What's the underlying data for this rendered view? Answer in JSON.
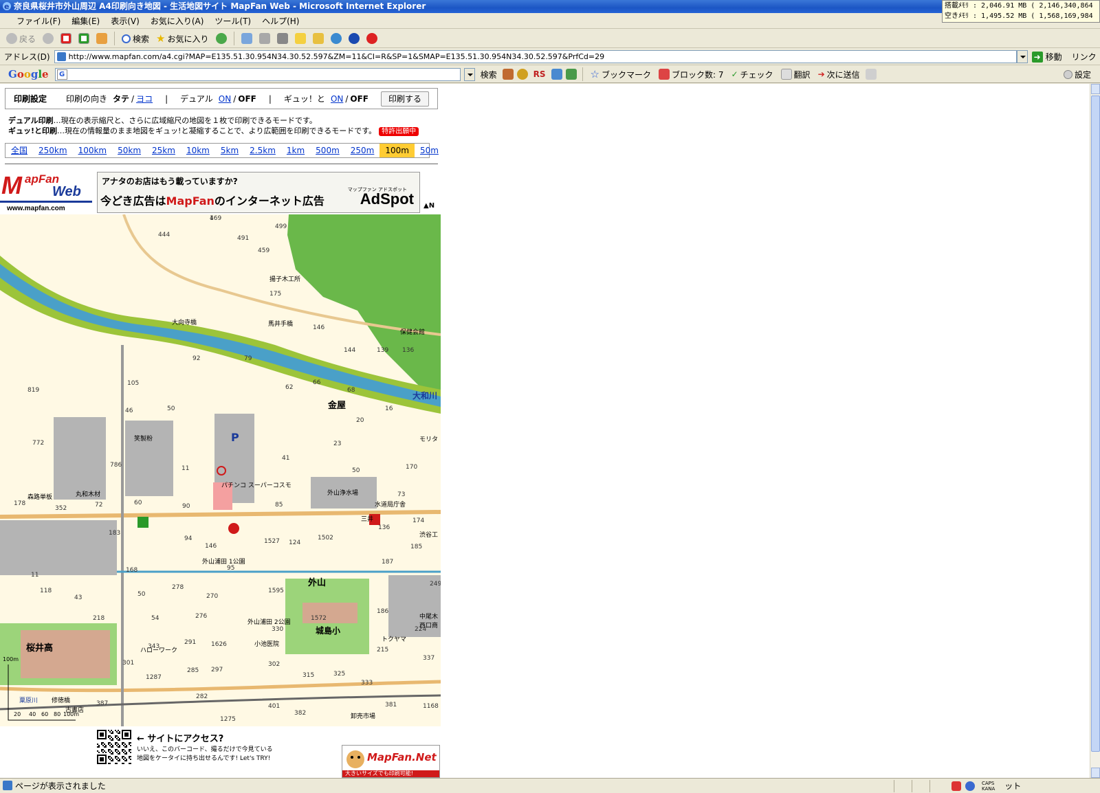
{
  "window": {
    "title": "奈良県桜井市外山周辺 A4印刷向き地図 - 生活地図サイト MapFan Web - Microsoft Internet Explorer",
    "memory_line1": "搭載ﾒﾓﾘ : 2,046.91 MB ( 2,146,340,864",
    "memory_line2": "空きﾒﾓﾘ : 1,495.52 MB ( 1,568,169,984"
  },
  "menu": [
    "ファイル(F)",
    "編集(E)",
    "表示(V)",
    "お気に入り(A)",
    "ツール(T)",
    "ヘルプ(H)"
  ],
  "toolbar": {
    "back": "戻る",
    "search": "検索",
    "favorites": "お気に入り"
  },
  "address": {
    "label": "アドレス(D)",
    "url": "http://www.mapfan.com/a4.cgi?MAP=E135.51.30.954N34.30.52.597&ZM=11&CI=R&SP=1&SMAP=E135.51.30.954N34.30.52.597&PrfCd=29",
    "go": "移動",
    "links": "リンク"
  },
  "googlebar": {
    "logo": [
      "G",
      "o",
      "o",
      "g",
      "l",
      "e"
    ],
    "search_btn": "検索",
    "rs": "RS",
    "bookmarks": "ブックマーク",
    "blocked": "ブロック数: 7",
    "check": "チェック",
    "translate": "翻訳",
    "send": "次に送信",
    "settings": "設定"
  },
  "print": {
    "heading": "印刷設定",
    "orientation_label": "印刷の向き",
    "portrait": "タテ",
    "slash": "/",
    "landscape": "ヨコ",
    "divider": "|",
    "dual_label": "デュアル",
    "on": "ON",
    "off": "OFF",
    "gyutto_label": "ギュッ！と",
    "button": "印刷する"
  },
  "description": {
    "dual_title": "デュアル印刷",
    "dual_text": "…現在の表示縮尺と、さらに広域縮尺の地図を１枚で印刷できるモードです。",
    "gyutto_title": "ギュッ!と印刷",
    "gyutto_text": "…現在の情報量のまま地図をギュッ!と凝縮することで、より広範囲を印刷できるモードです。",
    "patent": "特許出願中"
  },
  "scales": [
    {
      "label": "全国",
      "active": false
    },
    {
      "label": "250km",
      "active": false
    },
    {
      "label": "100km",
      "active": false
    },
    {
      "label": "50km",
      "active": false
    },
    {
      "label": "25km",
      "active": false
    },
    {
      "label": "10km",
      "active": false
    },
    {
      "label": "5km",
      "active": false
    },
    {
      "label": "2.5km",
      "active": false
    },
    {
      "label": "1km",
      "active": false
    },
    {
      "label": "500m",
      "active": false
    },
    {
      "label": "250m",
      "active": false
    },
    {
      "label": "100m",
      "active": true
    },
    {
      "label": "50m",
      "active": false
    }
  ],
  "logo": {
    "line1": "MapFan",
    "line2": "Web",
    "url": "www.mapfan.com"
  },
  "ad": {
    "line1": "アナタのお店はもう載っていますか?",
    "line2_pre": "今どき広告は",
    "line2_brand": "MapFan",
    "line2_post": "のインターネット広告",
    "brand_small": "マップファン アドスポット",
    "adspot": "AdSpot"
  },
  "north": "▲N",
  "map": {
    "labels": {
      "area_kanaya": "金屋",
      "area_toyama": "外山",
      "river": "大和川",
      "school_sakurai": "桜井高",
      "school_jojima": "城島小",
      "bridge_omukai": "大向寺橋",
      "bridge_umai": "馬井手橋",
      "parking": "P",
      "pachinko": "パチンコ スーパーコスモ",
      "kanji_factory": "笑製粉",
      "water_plant": "外山浄水場",
      "water_office": "水道局庁舎",
      "hoken": "保健会館",
      "moku_kogyo": "揚子木工所",
      "morita": "モリタ",
      "maruwa": "丸和木材",
      "morimichi": "森路単板",
      "park1": "外山浦田 1公園",
      "park2": "外山浦田 2公園",
      "koike": "小池医院",
      "hellowork": "ハローワーク",
      "tokuyama": "トクヤマ",
      "nakao": "中尾木",
      "nishida": "西口商",
      "shibutani": "渋谷工",
      "market": "卸売市場",
      "kayagawa": "粟原川",
      "shutokubashi": "修徳橋",
      "kosho": "古書店",
      "mitsui": "三井"
    },
    "numbers": [
      "469",
      "499",
      "444",
      "491",
      "459",
      "175",
      "146",
      "139",
      "136",
      "144",
      "92",
      "79",
      "105",
      "819",
      "62",
      "66",
      "68",
      "16",
      "20",
      "46",
      "50",
      "772",
      "23",
      "41",
      "786",
      "11",
      "50",
      "170",
      "178",
      "352",
      "72",
      "60",
      "90",
      "85",
      "73",
      "174",
      "183",
      "94",
      "1502",
      "146",
      "1527",
      "124",
      "136",
      "185",
      "187",
      "168",
      "95",
      "118",
      "43",
      "50",
      "278",
      "270",
      "1595",
      "249",
      "186",
      "218",
      "54",
      "276",
      "1572",
      "330",
      "224",
      "215",
      "343",
      "291",
      "1626",
      "301",
      "285",
      "297",
      "302",
      "315",
      "325",
      "333",
      "337",
      "1287",
      "282",
      "401",
      "382",
      "381",
      "1168",
      "1275",
      "387",
      "11",
      "1"
    ],
    "scale_labels": [
      "100m",
      "20",
      "40",
      "60",
      "80",
      "100m"
    ]
  },
  "footer": {
    "qr_title": "← サイトにアクセス?",
    "qr_text1": "いいえ、このバーコード、撮るだけで今見ている",
    "qr_text2": "地図をケータイに持ち出せるんです! Let's TRY!",
    "mfn_logo": "MapFan.Net",
    "mfn_strip": "大きいサイズでも印刷可能!"
  },
  "status": {
    "text": "ページが表示されました",
    "zone": "ット"
  }
}
